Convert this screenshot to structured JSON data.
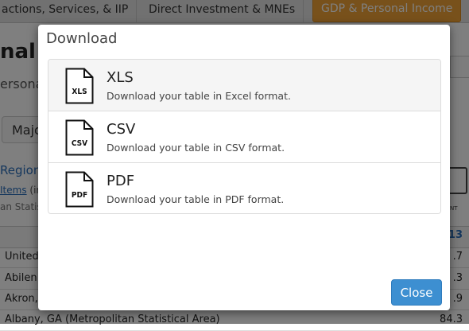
{
  "nav": {
    "tabs": [
      {
        "label": "actions, Services, & IIP"
      },
      {
        "label": "Direct Investment & MNEs"
      },
      {
        "label": "GDP & Personal Income"
      }
    ]
  },
  "background": {
    "title": "nal I",
    "subtitle": "ersona",
    "tab_button": "Majo",
    "regional_link": "Regiona",
    "items_link": "Items",
    "items_rest": "(in",
    "metro_text": "an Statis",
    "year_header": "13",
    "print_label": "NT",
    "rows": [
      {
        "name": "United",
        "value": ".7"
      },
      {
        "name": "Abilen",
        "value": ".3"
      },
      {
        "name": "Akron,",
        "value": ".9"
      },
      {
        "name": "Albany, GA (Metropolitan Statistical Area)",
        "value": "84.3"
      }
    ]
  },
  "modal": {
    "title": "Download",
    "options": [
      {
        "icon_label": "XLS",
        "name": "XLS",
        "description": "Download your table in Excel format."
      },
      {
        "icon_label": "CSV",
        "name": "CSV",
        "description": "Download your table in CSV format."
      },
      {
        "icon_label": "PDF",
        "name": "PDF",
        "description": "Download your table in PDF format."
      }
    ],
    "close_label": "Close"
  },
  "colors": {
    "accent_tab": "#f0a336",
    "close_button": "#3d8fd1",
    "link": "#2a6ebb"
  }
}
